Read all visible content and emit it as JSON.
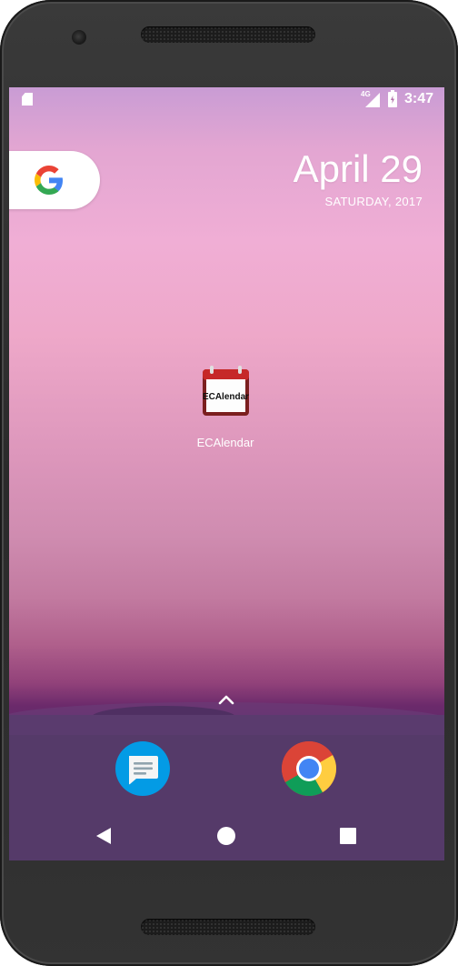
{
  "status_bar": {
    "network": "4G",
    "time": "3:47",
    "sd_icon": "sd-card-icon",
    "signal_icon": "cell-signal-icon",
    "battery_icon": "battery-charging-icon"
  },
  "search_widget": {
    "icon": "google-g-icon"
  },
  "date_widget": {
    "date": "April 29",
    "weekday_year": "SATURDAY, 2017"
  },
  "apps": [
    {
      "label": "ECAlendar",
      "icon": "ecalendar-app-icon",
      "icon_text": "ECAlendar"
    }
  ],
  "all_apps": {
    "icon": "chevron-up-icon"
  },
  "dock": [
    {
      "icon": "messages-app-icon"
    },
    {
      "icon": "chrome-app-icon"
    }
  ],
  "navigation": {
    "back": "back-icon",
    "home": "home-icon",
    "recents": "recents-icon"
  },
  "colors": {
    "google_blue": "#4285F4",
    "google_red": "#EA4335",
    "google_yellow": "#FBBC05",
    "google_green": "#34A853",
    "messages_blue": "#039BE5",
    "calendar_red": "#C62828"
  }
}
